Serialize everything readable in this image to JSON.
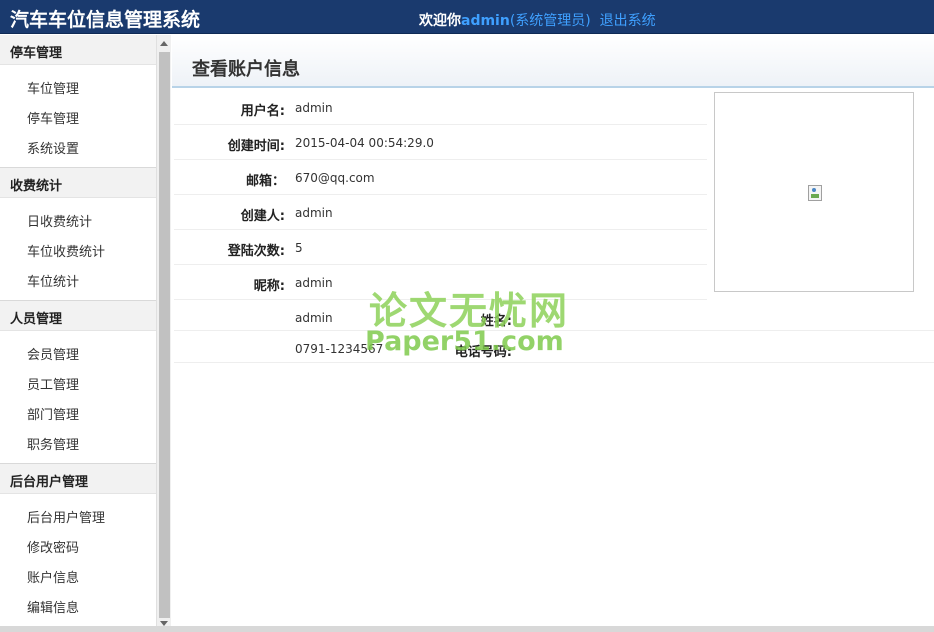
{
  "header": {
    "app_title": "汽车车位信息管理系统",
    "welcome_text": "欢迎你",
    "username": "admin",
    "role": "(系统管理员)",
    "logout": "退出系统",
    "bg_color": "#1a3a6e",
    "accent_color": "#3fa0ff"
  },
  "sidebar": {
    "groups": [
      {
        "title": "停车管理",
        "items": [
          "车位管理",
          "停车管理",
          "系统设置"
        ]
      },
      {
        "title": "收费统计",
        "items": [
          "日收费统计",
          "车位收费统计",
          "车位统计"
        ]
      },
      {
        "title": "人员管理",
        "items": [
          "会员管理",
          "员工管理",
          "部门管理",
          "职务管理"
        ]
      },
      {
        "title": "后台用户管理",
        "items": [
          "后台用户管理",
          "修改密码",
          "账户信息",
          "编辑信息"
        ]
      }
    ]
  },
  "main": {
    "title": "查看账户信息",
    "fields": [
      {
        "label": "用户名:",
        "value": "admin"
      },
      {
        "label": "创建时间:",
        "value": "2015-04-04 00:54:29.0"
      },
      {
        "label": "邮箱：",
        "value": "670@qq.com"
      },
      {
        "label": "创建人:",
        "value": "admin"
      },
      {
        "label": "登陆次数:",
        "value": "5"
      },
      {
        "label": "昵称:",
        "value": "admin"
      },
      {
        "label": "姓名:",
        "value": "admin"
      },
      {
        "label": "电话号码:",
        "value": "0791-1234567"
      }
    ],
    "photo_icon": "broken-image-icon"
  },
  "watermark": {
    "cn": "论文无忧网",
    "en": "Paper51.com"
  }
}
